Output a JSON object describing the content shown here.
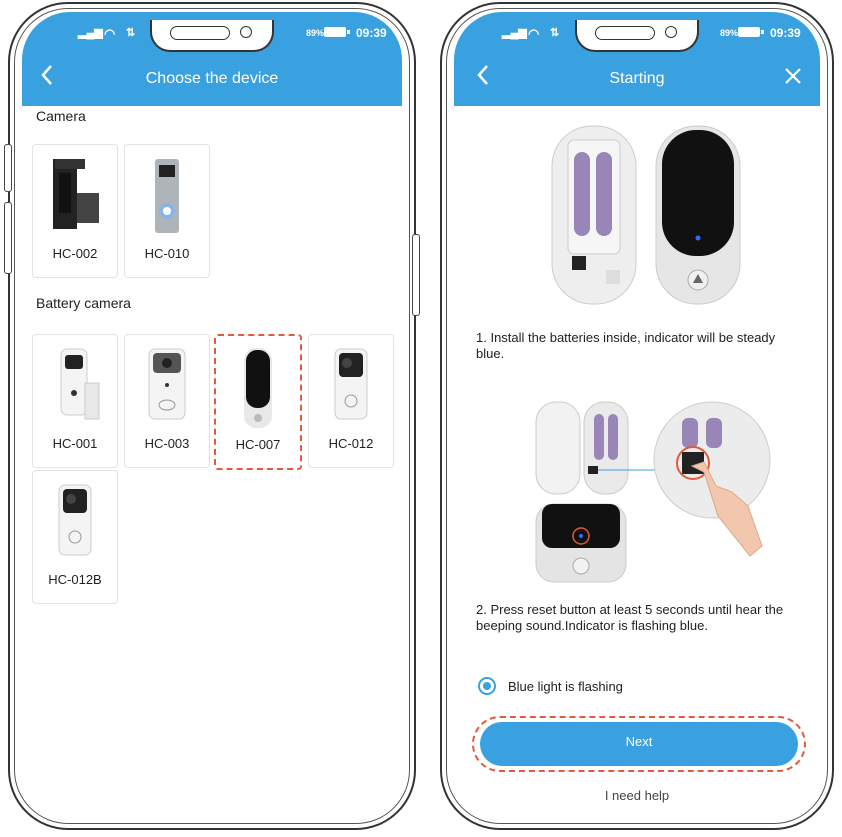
{
  "status_bar": {
    "time": "09:39",
    "battery_percent": "89%"
  },
  "left_screen": {
    "title": "Choose the device",
    "sections": [
      {
        "title": "Camera",
        "devices": [
          "HC-002",
          "HC-010"
        ]
      },
      {
        "title": "Battery camera",
        "devices": [
          "HC-001",
          "HC-003",
          "HC-007",
          "HC-012",
          "HC-012B"
        ]
      }
    ],
    "selected_device": "HC-007"
  },
  "right_screen": {
    "title": "Starting",
    "step1": "1. Install the batteries inside, indicator will be steady blue.",
    "step2": "2. Press reset button at least 5 seconds until hear the beeping sound.Indicator is flashing blue.",
    "radio_label": "Blue light is flashing",
    "next_label": "Next",
    "help_label": "I need help"
  },
  "colors": {
    "accent": "#3aa1e0",
    "highlight": "#e25a3a"
  }
}
